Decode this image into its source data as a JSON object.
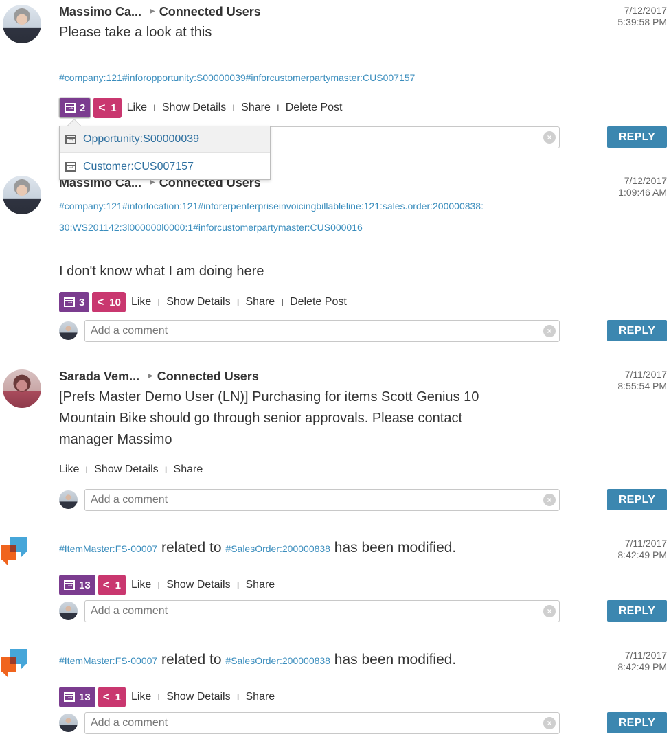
{
  "posts": [
    {
      "author": "Massimo Ca...",
      "group": "Connected Users",
      "date": "7/12/2017",
      "time": "5:39:58 PM",
      "message": "Please take a look at this",
      "tags": "#company:121#inforopportunity:S00000039#inforcustomerpartymaster:CUS007157",
      "objects_count": "2",
      "shares_count": "1",
      "actions": [
        "Like",
        "Show Details",
        "Share",
        "Delete Post"
      ],
      "comment_placeholder": "Add a comment",
      "reply_label": "REPLY"
    },
    {
      "author": "Massimo Ca...",
      "group": "Connected Users",
      "date": "7/12/2017",
      "time": "1:09:46 AM",
      "tags_line1": "#company:121#inforlocation:121#inforerpenterpriseinvoicingbillableline:121:sales.order:200000838:",
      "tags_line2": "30:WS201142:3l000000l0000:1#inforcustomerpartymaster:CUS000016",
      "message": "I don't know what I am doing here",
      "objects_count": "3",
      "shares_count": "10",
      "actions": [
        "Like",
        "Show Details",
        "Share",
        "Delete Post"
      ],
      "comment_placeholder": "Add a comment",
      "reply_label": "REPLY"
    },
    {
      "author": "Sarada Vem...",
      "group": "Connected Users",
      "date": "7/11/2017",
      "time": "8:55:54 PM",
      "message_line1": "[Prefs Master Demo User (LN)] Purchasing for items Scott Genius 10",
      "message_line2": "Mountain Bike should go through senior approvals. Please contact",
      "message_line3": "manager Massimo",
      "actions": [
        "Like",
        "Show Details",
        "Share"
      ],
      "comment_placeholder": "Add a comment",
      "reply_label": "REPLY"
    },
    {
      "tag1": "#ItemMaster:FS-00007",
      "mid": " related to ",
      "tag2": "#SalesOrder:200000838",
      "end": " has been modified.",
      "date": "7/11/2017",
      "time": "8:42:49 PM",
      "objects_count": "13",
      "shares_count": "1",
      "actions": [
        "Like",
        "Show Details",
        "Share"
      ],
      "comment_placeholder": "Add a comment",
      "reply_label": "REPLY"
    },
    {
      "tag1": "#ItemMaster:FS-00007",
      "mid": " related to ",
      "tag2": "#SalesOrder:200000838",
      "end": " has been modified.",
      "date": "7/11/2017",
      "time": "8:42:49 PM",
      "objects_count": "13",
      "shares_count": "1",
      "actions": [
        "Like",
        "Show Details",
        "Share"
      ],
      "comment_placeholder": "Add a comment",
      "reply_label": "REPLY"
    }
  ],
  "popup": {
    "items": [
      "Opportunity:S00000039",
      "Customer:CUS007157"
    ]
  },
  "icons": {
    "object": "linked-object-icon",
    "share": "share-icon",
    "clear": "clear-icon",
    "caret": "caret-right-icon"
  },
  "colors": {
    "tag_link": "#3a8dbd",
    "object_badge": "#7b3c8f",
    "share_badge": "#c9376f",
    "reply_button": "#3c87b0"
  }
}
